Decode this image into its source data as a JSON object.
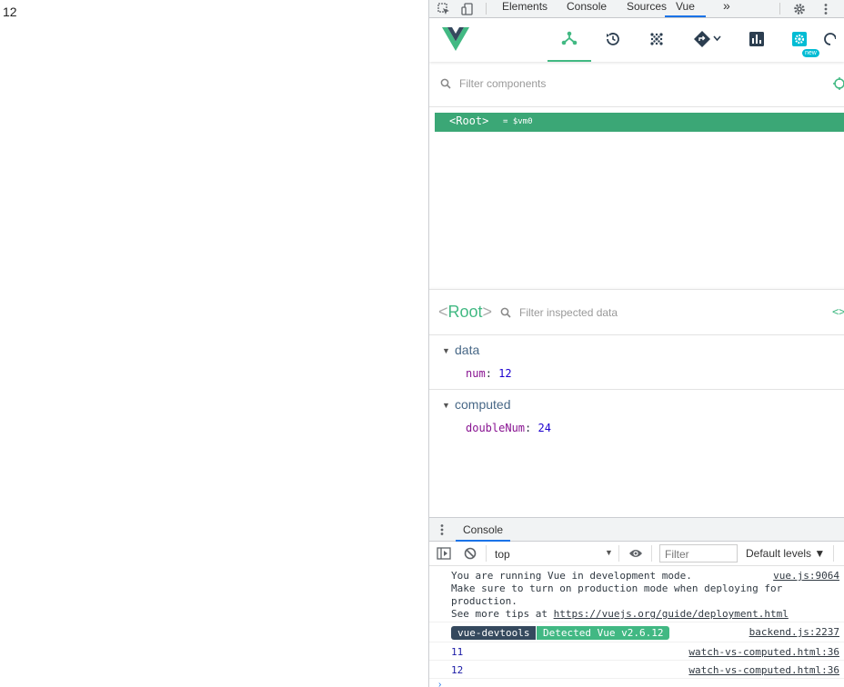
{
  "page": {
    "output_text": "12"
  },
  "devtools_tabs": {
    "items": [
      "Elements",
      "Console",
      "Sources",
      "Vue"
    ],
    "active": "Vue",
    "more": "»"
  },
  "vue_toolbar": {
    "new_badge": "new",
    "accent": "#42b983"
  },
  "components": {
    "filter_placeholder": "Filter components",
    "root_label": "<Root>",
    "root_vm": "= $vm0"
  },
  "inspector": {
    "component_name": "Root",
    "open_bracket": "<",
    "close_bracket": ">",
    "filter_placeholder": "Filter inspected data",
    "sections": [
      {
        "title": "data",
        "props": [
          {
            "key": "num",
            "value": "12"
          }
        ]
      },
      {
        "title": "computed",
        "props": [
          {
            "key": "doubleNum",
            "value": "24"
          }
        ]
      }
    ]
  },
  "console": {
    "tab_label": "Console",
    "context": "top",
    "filter_placeholder": "Filter",
    "levels": "Default levels ▼",
    "messages": {
      "dev_mode_line1": "You are running Vue in development mode.",
      "dev_mode_line2": "Make sure to turn on production mode when deploying for",
      "dev_mode_line3": "production.",
      "dev_mode_line4_prefix": "See more tips at ",
      "dev_mode_link": "https://vuejs.org/guide/deployment.html",
      "dev_mode_source": "vue.js:9064",
      "devtools_badge": "vue-devtools",
      "detected_badge": "Detected Vue v2.6.12",
      "devtools_source": "backend.js:2237",
      "log1_value": "11",
      "log1_source": "watch-vs-computed.html:36",
      "log2_value": "12",
      "log2_source": "watch-vs-computed.html:36"
    }
  }
}
